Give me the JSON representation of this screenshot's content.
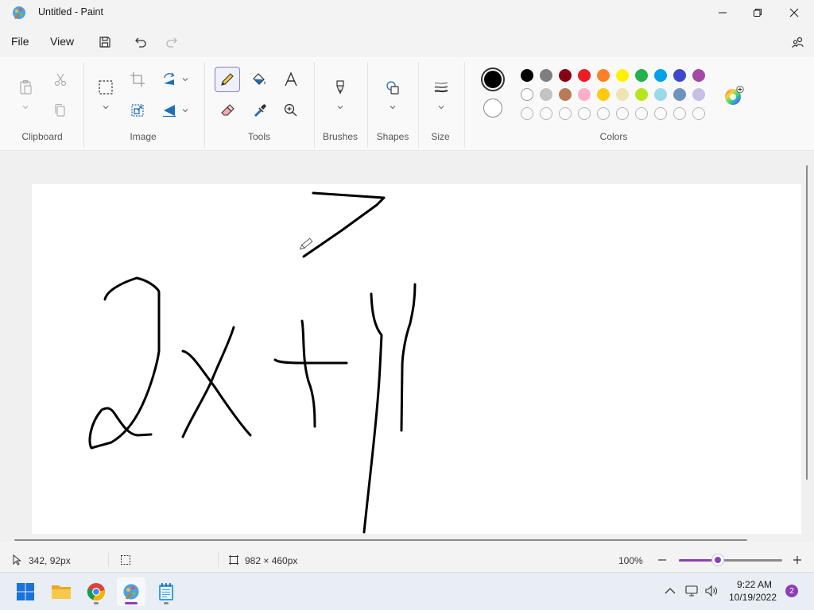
{
  "window": {
    "title": "Untitled - Paint"
  },
  "menu": {
    "file": "File",
    "view": "View"
  },
  "ribbon": {
    "groups": {
      "clipboard": "Clipboard",
      "image": "Image",
      "tools": "Tools",
      "brushes": "Brushes",
      "shapes": "Shapes",
      "size": "Size",
      "colors": "Colors"
    },
    "active_tool": "pencil",
    "primary_color": "#000000",
    "secondary_color": "#ffffff",
    "palette_row1": [
      "#000000",
      "#7f7f7f",
      "#880015",
      "#ed1c24",
      "#ff7f27",
      "#fff200",
      "#22b14c",
      "#00a2e8",
      "#3f48cc",
      "#a349a4"
    ],
    "palette_row2": [
      "#ffffff",
      "#c3c3c3",
      "#b97a57",
      "#ffaec9",
      "#ffc90e",
      "#efe4b0",
      "#b5e61d",
      "#99d9ea",
      "#7092be",
      "#c8bfe7"
    ],
    "custom_slots": 10
  },
  "status": {
    "cursor_pos": "342, 92px",
    "canvas_size": "982 × 460px",
    "zoom": "100%",
    "zoom_fraction": 0.38
  },
  "taskbar": {
    "time": "9:22 AM",
    "date": "10/19/2022",
    "notifications": "2"
  }
}
